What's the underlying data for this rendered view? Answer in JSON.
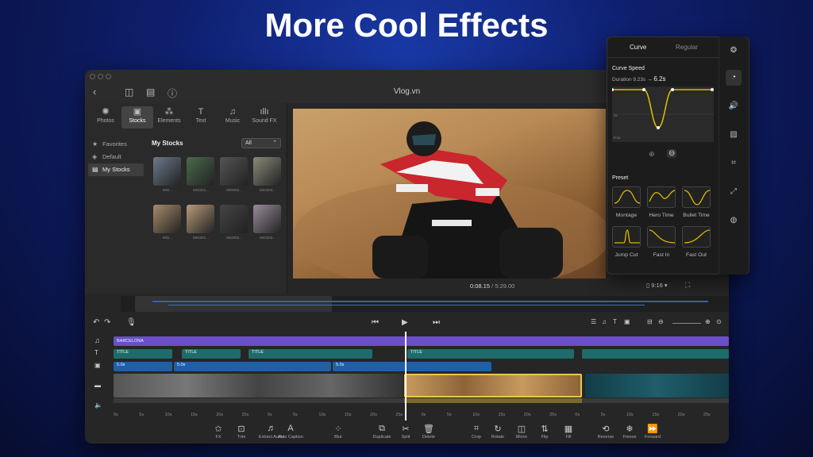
{
  "headline": "More Cool Effects",
  "window": {
    "title": "Vlog.vn",
    "library_tabs": [
      {
        "label": "Photos",
        "icon": "photos-icon",
        "glyph": "✺"
      },
      {
        "label": "Stocks",
        "icon": "stocks-icon",
        "glyph": "▣"
      },
      {
        "label": "Elements",
        "icon": "elements-icon",
        "glyph": "⁂"
      },
      {
        "label": "Text",
        "icon": "text-icon",
        "glyph": "T"
      },
      {
        "label": "Music",
        "icon": "music-icon",
        "glyph": "♫"
      },
      {
        "label": "Sound FX",
        "icon": "sound-fx-icon",
        "glyph": "ıllı"
      }
    ],
    "sidebar": [
      {
        "label": "Favorites",
        "glyph": "★"
      },
      {
        "label": "Default",
        "glyph": "◈"
      },
      {
        "label": "My Stocks",
        "glyph": "▤"
      }
    ],
    "stocks_title": "My Stocks",
    "filter": {
      "value": "All",
      "caret": "⌃"
    },
    "thumbnails": [
      {
        "caption": "IMG..."
      },
      {
        "caption": "IMG001..."
      },
      {
        "caption": "IMG002..."
      },
      {
        "caption": "IMG003..."
      },
      {
        "caption": "IMG..."
      },
      {
        "caption": "IMG001..."
      },
      {
        "caption": "IMG002..."
      },
      {
        "caption": "IMG003..."
      }
    ],
    "preview": {
      "current": "0:08.15",
      "total": "5:29.00",
      "separator": "/",
      "ratio": "9:16 ▾"
    },
    "tracks": {
      "audio_label": "BARCELONA",
      "title_clip": "TITLE",
      "sub_duration": "5.0s",
      "ruler": [
        "0s",
        "5s",
        "10s",
        "15s",
        "20s",
        "25s",
        "0s",
        "5s",
        "10s",
        "15s",
        "20s",
        "25s",
        "0s",
        "5s",
        "10s",
        "15s",
        "20s",
        "25s",
        "0s",
        "5s",
        "10s",
        "15s",
        "20s",
        "25s"
      ]
    },
    "tools": [
      {
        "label": "FX",
        "glyph": "✩"
      },
      {
        "label": "Trim",
        "glyph": "⊡"
      },
      {
        "label": "Extract Audio",
        "glyph": "♬"
      },
      {
        "label": "Auto Caption",
        "glyph": "A"
      },
      {
        "label": "Blur",
        "glyph": "⁘"
      },
      {
        "label": "Duplicate",
        "glyph": "⧉"
      },
      {
        "label": "Split",
        "glyph": "✂"
      },
      {
        "label": "Delete",
        "glyph": "🗑"
      },
      {
        "label": "Crop",
        "glyph": "⌗"
      },
      {
        "label": "Rotate",
        "glyph": "↻"
      },
      {
        "label": "Mirror",
        "glyph": "◫"
      },
      {
        "label": "Flip",
        "glyph": "⇅"
      },
      {
        "label": "Fill",
        "glyph": "▦"
      },
      {
        "label": "Reverse",
        "glyph": "⟲"
      },
      {
        "label": "Freeze",
        "glyph": "❄"
      },
      {
        "label": "Forward",
        "glyph": "⏩"
      }
    ]
  },
  "speed_panel": {
    "tabs": [
      "Curve",
      "Regular"
    ],
    "title": "Curve Speed",
    "duration_label": "Duration",
    "duration_from": "9.23s",
    "arrow": "→",
    "duration_to": "6.2s",
    "axis_mid": "1x",
    "axis_low": "0.1x",
    "preset_label": "Preset",
    "presets": [
      "Montage",
      "Hero Time",
      "Bullet Time",
      "Jump Cut",
      "Fast In",
      "Fast Out"
    ]
  },
  "colors": {
    "accent": "#d9b800",
    "audio_track": "#6a4fc7",
    "title_track": "#1e6b6b",
    "video_selected": "#e8c84a"
  }
}
